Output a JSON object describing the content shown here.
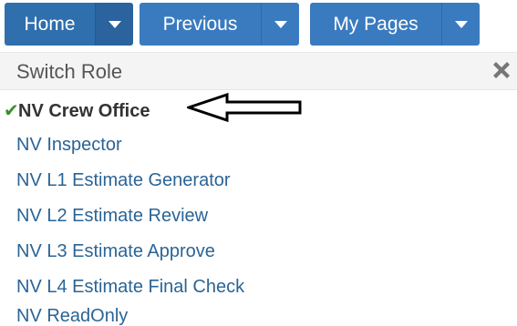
{
  "nav": {
    "home_label": "Home",
    "previous_label": "Previous",
    "mypages_label": "My Pages"
  },
  "panel": {
    "title": "Switch Role",
    "close_icon": "close-icon"
  },
  "roles": [
    {
      "label": "NV Crew Office",
      "active": true
    },
    {
      "label": "NV Inspector",
      "active": false
    },
    {
      "label": "NV L1 Estimate Generator",
      "active": false
    },
    {
      "label": "NV L2 Estimate Review",
      "active": false
    },
    {
      "label": "NV L3 Estimate Approve",
      "active": false
    },
    {
      "label": "NV L4 Estimate Final Check",
      "active": false
    },
    {
      "label": "NV ReadOnly",
      "active": false
    }
  ],
  "colors": {
    "nav_blue": "#3a7bbf",
    "link_blue": "#2a6496",
    "check_green": "#3c8d2f"
  }
}
